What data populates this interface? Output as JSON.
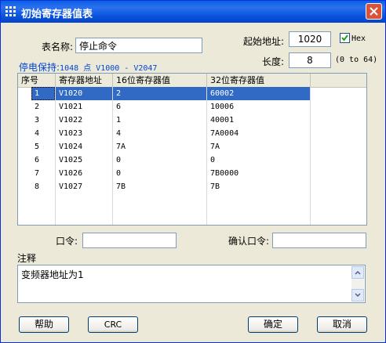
{
  "window": {
    "title": "初始寄存器值表"
  },
  "form": {
    "table_name_label": "表名称:",
    "table_name_value": "停止命令",
    "start_addr_label": "起始地址:",
    "start_addr_value": "1020",
    "hex_label": "Hex",
    "hex_checked": true,
    "length_label": "长度:",
    "length_value": "8",
    "length_hint": "(0 to 64)",
    "retain_label": "停电保持:",
    "retain_range": "1048 点 V1000 - V2047"
  },
  "table": {
    "columns": [
      "序号",
      "寄存器地址",
      "16位寄存器值",
      "32位寄存器值"
    ],
    "rows": [
      {
        "no": "1",
        "addr": "V1020",
        "v16": "2",
        "v32": "60002"
      },
      {
        "no": "2",
        "addr": "V1021",
        "v16": "6",
        "v32": "10006"
      },
      {
        "no": "3",
        "addr": "V1022",
        "v16": "1",
        "v32": "40001"
      },
      {
        "no": "4",
        "addr": "V1023",
        "v16": "4",
        "v32": "7A0004"
      },
      {
        "no": "5",
        "addr": "V1024",
        "v16": "7A",
        "v32": "7A"
      },
      {
        "no": "6",
        "addr": "V1025",
        "v16": "0",
        "v32": "0"
      },
      {
        "no": "7",
        "addr": "V1026",
        "v16": "0",
        "v32": "7B0000"
      },
      {
        "no": "8",
        "addr": "V1027",
        "v16": "7B",
        "v32": "7B"
      }
    ],
    "selected_index": 0
  },
  "password": {
    "label": "口令:",
    "value": "",
    "confirm_label": "确认口令:",
    "confirm_value": ""
  },
  "note": {
    "label": "注释",
    "value": "变频器地址为1"
  },
  "buttons": {
    "help": "帮助",
    "crc": "CRC",
    "ok": "确定",
    "cancel": "取消"
  },
  "icons": {
    "app": "grid-app-icon",
    "close": "close-icon",
    "check": "checkmark-icon",
    "scroll_up": "scroll-up-icon",
    "scroll_down": "scroll-down-icon"
  },
  "colors": {
    "titlebar": "#0A5FE6",
    "selection": "#316AC5",
    "close": "#D9533A"
  }
}
